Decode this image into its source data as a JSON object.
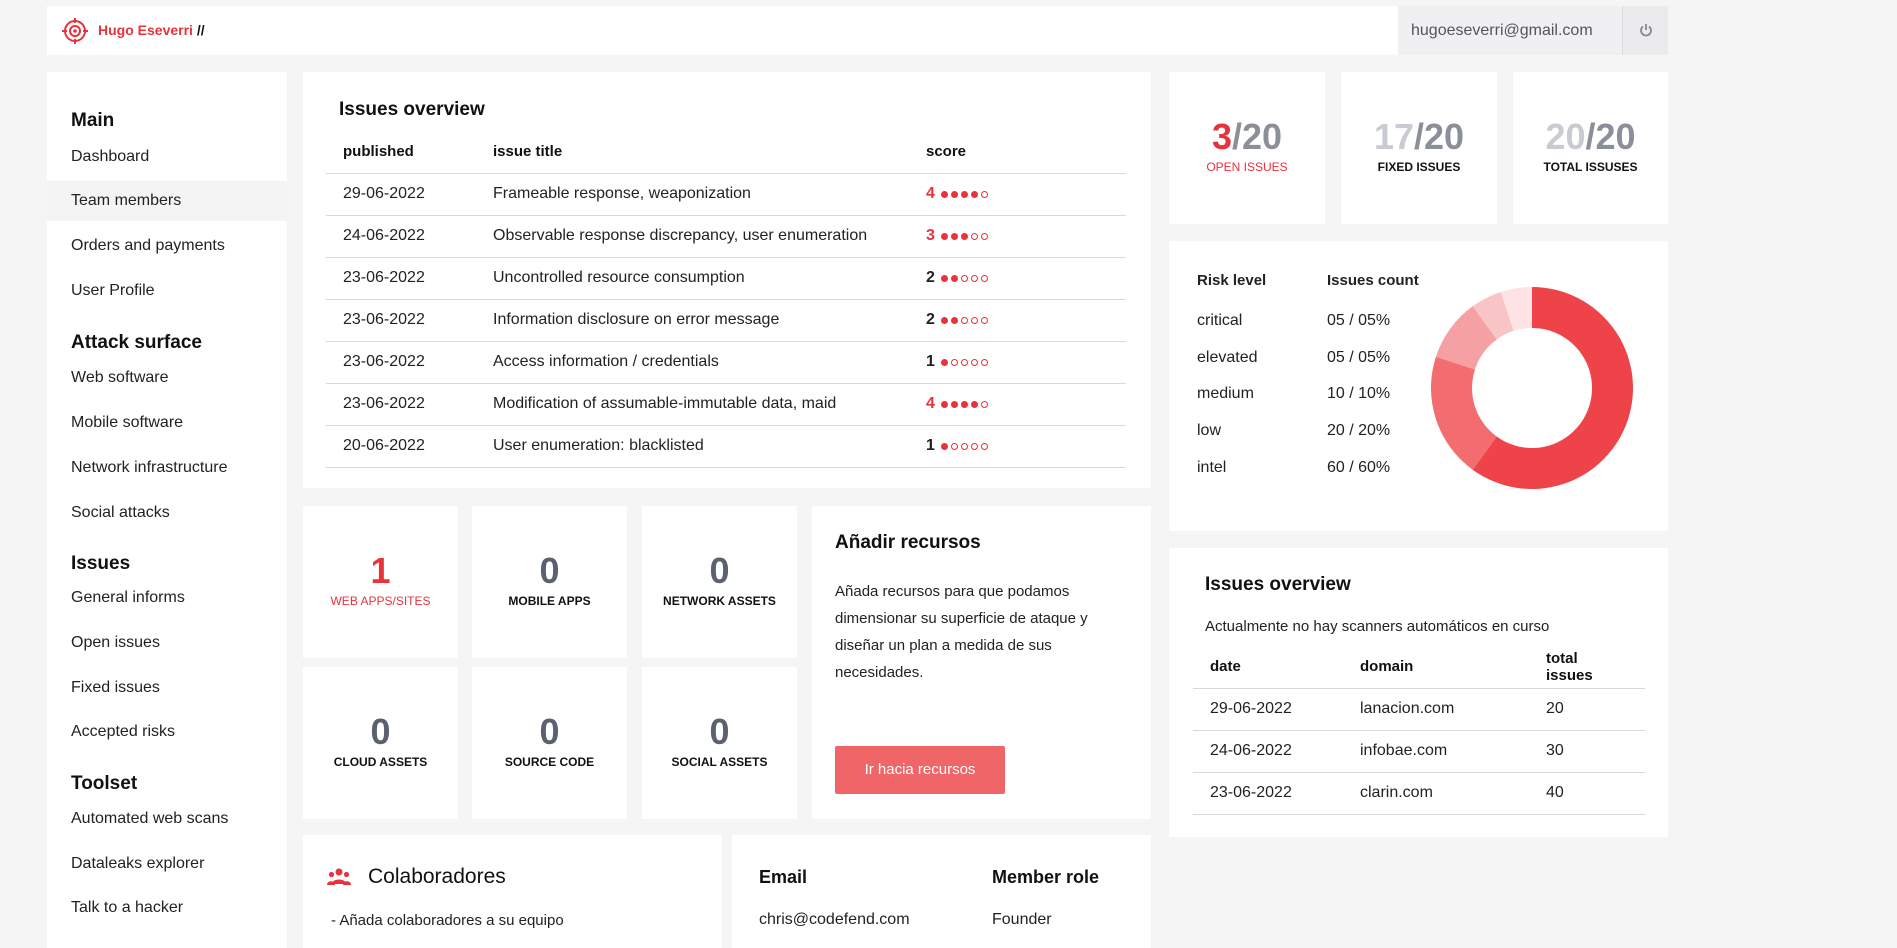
{
  "header": {
    "brand_name": "Hugo Eseverri",
    "brand_suffix": "//",
    "user_email": "hugoeseverri@gmail.com",
    "accent": "#e8323c"
  },
  "sidebar": {
    "sections": [
      {
        "title": "Main",
        "items": [
          {
            "label": "Dashboard"
          },
          {
            "label": "Team members",
            "active": true
          },
          {
            "label": "Orders and payments"
          },
          {
            "label": "User Profile"
          }
        ]
      },
      {
        "title": "Attack surface",
        "items": [
          {
            "label": "Web software"
          },
          {
            "label": "Mobile software"
          },
          {
            "label": "Network infrastructure"
          },
          {
            "label": "Social attacks"
          }
        ]
      },
      {
        "title": "Issues",
        "items": [
          {
            "label": "General informs"
          },
          {
            "label": "Open issues"
          },
          {
            "label": "Fixed issues"
          },
          {
            "label": "Accepted risks"
          }
        ]
      },
      {
        "title": "Toolset",
        "items": [
          {
            "label": "Automated web scans"
          },
          {
            "label": "Dataleaks explorer"
          },
          {
            "label": "Talk to a hacker"
          }
        ]
      }
    ]
  },
  "issues_overview": {
    "title": "Issues overview",
    "columns": [
      "published",
      "issue title",
      "score"
    ],
    "rows": [
      {
        "published": "29-06-2022",
        "title": "Frameable response, weaponization",
        "score": 4
      },
      {
        "published": "24-06-2022",
        "title": "Observable response discrepancy, user enumeration",
        "score": 3
      },
      {
        "published": "23-06-2022",
        "title": "Uncontrolled resource consumption",
        "score": 2
      },
      {
        "published": "23-06-2022",
        "title": "Information disclosure on error message",
        "score": 2
      },
      {
        "published": "23-06-2022",
        "title": "Access information / credentials",
        "score": 1
      },
      {
        "published": "23-06-2022",
        "title": "Modification of assumable-immutable data, maid",
        "score": 4
      },
      {
        "published": "20-06-2022",
        "title": "User enumeration: blacklisted",
        "score": 1
      }
    ]
  },
  "issue_stats": {
    "open": {
      "value": "3",
      "total": "/20",
      "label": "OPEN ISSUES"
    },
    "fixed": {
      "value": "17",
      "total": "/20",
      "label": "FIXED ISSUES"
    },
    "total": {
      "value": "20",
      "total": "/20",
      "label": "TOTAL ISSUSES"
    }
  },
  "risk": {
    "col_level": "Risk level",
    "col_count": "Issues count",
    "rows": [
      {
        "level": "critical",
        "count": "05 / 05%"
      },
      {
        "level": "elevated",
        "count": "05 / 05%"
      },
      {
        "level": "medium",
        "count": "10 / 10%"
      },
      {
        "level": "low",
        "count": "20 / 20%"
      },
      {
        "level": "intel",
        "count": "60 / 60%"
      }
    ]
  },
  "chart_data": {
    "type": "pie",
    "categories": [
      "intel",
      "low",
      "medium",
      "elevated",
      "critical"
    ],
    "values": [
      60,
      20,
      10,
      5,
      5
    ],
    "colors": [
      "#ee4449",
      "#f26c70",
      "#f5a0a2",
      "#f9c4c5",
      "#fde3e4"
    ]
  },
  "assets": [
    {
      "value": "1",
      "label": "WEB APPS/SITES",
      "highlight": true
    },
    {
      "value": "0",
      "label": "MOBILE APPS"
    },
    {
      "value": "0",
      "label": "NETWORK ASSETS"
    },
    {
      "value": "0",
      "label": "CLOUD ASSETS"
    },
    {
      "value": "0",
      "label": "SOURCE CODE"
    },
    {
      "value": "0",
      "label": "SOCIAL ASSETS"
    }
  ],
  "resources": {
    "title": "Añadir recursos",
    "body": "Añada recursos para que podamos dimensionar su superficie de ataque y diseñar un plan a medida de sus necesidades.",
    "button": "Ir hacia recursos"
  },
  "scans": {
    "title": "Issues overview",
    "subtitle": "Actualmente no hay scanners automáticos en curso",
    "columns": [
      "date",
      "domain",
      "total issues"
    ],
    "rows": [
      {
        "date": "29-06-2022",
        "domain": "lanacion.com",
        "total": "20"
      },
      {
        "date": "24-06-2022",
        "domain": "infobae.com",
        "total": "30"
      },
      {
        "date": "23-06-2022",
        "domain": "clarin.com",
        "total": "40"
      }
    ]
  },
  "collab": {
    "title": "Colaboradores",
    "subtitle": "- Añada colaboradores a su equipo"
  },
  "members": {
    "col_email": "Email",
    "col_role": "Member role",
    "rows": [
      {
        "email": "chris@codefend.com",
        "role": "Founder"
      }
    ]
  }
}
